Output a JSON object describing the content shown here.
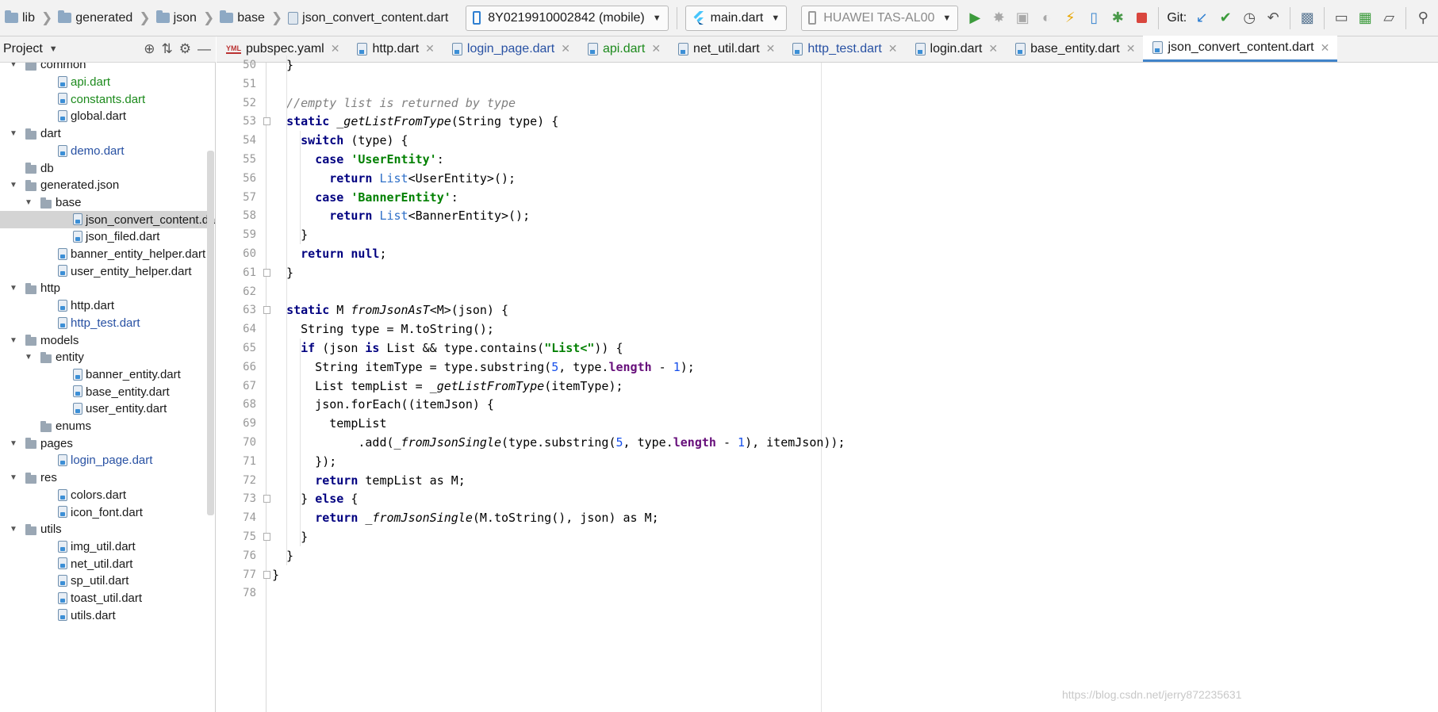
{
  "breadcrumb": {
    "items": [
      "lib",
      "generated",
      "json",
      "base",
      "json_convert_content.dart"
    ]
  },
  "toolbar": {
    "device_selector": "8Y0219910002842 (mobile)",
    "run_config": "main.dart",
    "target_device": "HUAWEI TAS-AL00",
    "git_label": "Git:",
    "icons": [
      "run-icon",
      "debug-icon",
      "profile-icon",
      "attach-icon",
      "hot-reload-icon",
      "device-icon",
      "stop-debug-icon",
      "stop-icon",
      "vcs-update-icon",
      "vcs-commit-icon",
      "history-icon",
      "revert-icon",
      "project-structure-icon",
      "terminal-icon",
      "avd-icon",
      "sdk-icon",
      "search-icon"
    ]
  },
  "project_panel": {
    "title": "Project",
    "tree": [
      {
        "label": "common",
        "kind": "folder",
        "depth": 1,
        "expanded": true,
        "color": "dark"
      },
      {
        "label": "api.dart",
        "kind": "file",
        "depth": 2,
        "color": "green"
      },
      {
        "label": "constants.dart",
        "kind": "file",
        "depth": 2,
        "color": "green"
      },
      {
        "label": "global.dart",
        "kind": "file",
        "depth": 2,
        "color": "dark"
      },
      {
        "label": "dart",
        "kind": "folder",
        "depth": 1,
        "expanded": true,
        "color": "dark"
      },
      {
        "label": "demo.dart",
        "kind": "file",
        "depth": 2,
        "color": "blue"
      },
      {
        "label": "db",
        "kind": "folder",
        "depth": 1,
        "expanded": false,
        "color": "dark"
      },
      {
        "label": "generated.json",
        "kind": "folder",
        "depth": 1,
        "expanded": true,
        "color": "dark"
      },
      {
        "label": "base",
        "kind": "folder",
        "depth": 2,
        "expanded": true,
        "color": "dark"
      },
      {
        "label": "json_convert_content.dart",
        "kind": "file",
        "depth": 3,
        "color": "dark",
        "selected": true
      },
      {
        "label": "json_filed.dart",
        "kind": "file",
        "depth": 3,
        "color": "dark"
      },
      {
        "label": "banner_entity_helper.dart",
        "kind": "file",
        "depth": 2,
        "color": "dark"
      },
      {
        "label": "user_entity_helper.dart",
        "kind": "file",
        "depth": 2,
        "color": "dark"
      },
      {
        "label": "http",
        "kind": "folder",
        "depth": 1,
        "expanded": true,
        "color": "dark"
      },
      {
        "label": "http.dart",
        "kind": "file",
        "depth": 2,
        "color": "dark"
      },
      {
        "label": "http_test.dart",
        "kind": "file",
        "depth": 2,
        "color": "blue"
      },
      {
        "label": "models",
        "kind": "folder",
        "depth": 1,
        "expanded": true,
        "color": "dark"
      },
      {
        "label": "entity",
        "kind": "folder",
        "depth": 2,
        "expanded": true,
        "color": "dark"
      },
      {
        "label": "banner_entity.dart",
        "kind": "file",
        "depth": 3,
        "color": "dark"
      },
      {
        "label": "base_entity.dart",
        "kind": "file",
        "depth": 3,
        "color": "dark"
      },
      {
        "label": "user_entity.dart",
        "kind": "file",
        "depth": 3,
        "color": "dark"
      },
      {
        "label": "enums",
        "kind": "folder",
        "depth": 2,
        "expanded": false,
        "color": "dark"
      },
      {
        "label": "pages",
        "kind": "folder",
        "depth": 1,
        "expanded": true,
        "color": "dark"
      },
      {
        "label": "login_page.dart",
        "kind": "file",
        "depth": 2,
        "color": "blue"
      },
      {
        "label": "res",
        "kind": "folder",
        "depth": 1,
        "expanded": true,
        "color": "dark"
      },
      {
        "label": "colors.dart",
        "kind": "file",
        "depth": 2,
        "color": "dark"
      },
      {
        "label": "icon_font.dart",
        "kind": "file",
        "depth": 2,
        "color": "dark"
      },
      {
        "label": "utils",
        "kind": "folder",
        "depth": 1,
        "expanded": true,
        "color": "dark"
      },
      {
        "label": "img_util.dart",
        "kind": "file",
        "depth": 2,
        "color": "dark"
      },
      {
        "label": "net_util.dart",
        "kind": "file",
        "depth": 2,
        "color": "dark"
      },
      {
        "label": "sp_util.dart",
        "kind": "file",
        "depth": 2,
        "color": "dark"
      },
      {
        "label": "toast_util.dart",
        "kind": "file",
        "depth": 2,
        "color": "dark"
      },
      {
        "label": "utils.dart",
        "kind": "file",
        "depth": 2,
        "color": "dark"
      }
    ]
  },
  "tabs": [
    {
      "label": "pubspec.yaml",
      "icon": "yaml-file-icon",
      "color": "dark",
      "active": false
    },
    {
      "label": "http.dart",
      "icon": "dart-file-icon",
      "color": "dark",
      "active": false
    },
    {
      "label": "login_page.dart",
      "icon": "dart-file-icon",
      "color": "blue",
      "active": false
    },
    {
      "label": "api.dart",
      "icon": "dart-file-icon",
      "color": "green",
      "active": false
    },
    {
      "label": "net_util.dart",
      "icon": "dart-file-icon",
      "color": "dark",
      "active": false
    },
    {
      "label": "http_test.dart",
      "icon": "dart-file-icon",
      "color": "blue",
      "active": false
    },
    {
      "label": "login.dart",
      "icon": "dart-file-icon",
      "color": "dark",
      "active": false
    },
    {
      "label": "base_entity.dart",
      "icon": "dart-file-icon",
      "color": "dark",
      "active": false
    },
    {
      "label": "json_convert_content.dart",
      "icon": "dart-file-icon",
      "color": "dark",
      "active": true
    }
  ],
  "editor": {
    "lines": [
      {
        "num": "50",
        "text": "  }"
      },
      {
        "num": "51",
        "text": ""
      },
      {
        "num": "52",
        "text": "  //empty list is returned by type"
      },
      {
        "num": "53",
        "text": "  static _getListFromType(String type) {"
      },
      {
        "num": "54",
        "text": "    switch (type) {"
      },
      {
        "num": "55",
        "text": "      case 'UserEntity':"
      },
      {
        "num": "56",
        "text": "        return List<UserEntity>();"
      },
      {
        "num": "57",
        "text": "      case 'BannerEntity':"
      },
      {
        "num": "58",
        "text": "        return List<BannerEntity>();"
      },
      {
        "num": "59",
        "text": "    }"
      },
      {
        "num": "60",
        "text": "    return null;"
      },
      {
        "num": "61",
        "text": "  }"
      },
      {
        "num": "62",
        "text": ""
      },
      {
        "num": "63",
        "text": "  static M fromJsonAsT<M>(json) {"
      },
      {
        "num": "64",
        "text": "    String type = M.toString();"
      },
      {
        "num": "65",
        "text": "    if (json is List && type.contains(\"List<\")) {"
      },
      {
        "num": "66",
        "text": "      String itemType = type.substring(5, type.length - 1);"
      },
      {
        "num": "67",
        "text": "      List tempList = _getListFromType(itemType);"
      },
      {
        "num": "68",
        "text": "      json.forEach((itemJson) {"
      },
      {
        "num": "69",
        "text": "        tempList"
      },
      {
        "num": "70",
        "text": "            .add(_fromJsonSingle(type.substring(5, type.length - 1), itemJson));"
      },
      {
        "num": "71",
        "text": "      });"
      },
      {
        "num": "72",
        "text": "      return tempList as M;"
      },
      {
        "num": "73",
        "text": "    } else {"
      },
      {
        "num": "74",
        "text": "      return _fromJsonSingle(M.toString(), json) as M;"
      },
      {
        "num": "75",
        "text": "    }"
      },
      {
        "num": "76",
        "text": "  }"
      },
      {
        "num": "77",
        "text": "}"
      },
      {
        "num": "78",
        "text": ""
      }
    ]
  },
  "watermark": "https://blog.csdn.net/jerry872235631",
  "colors": {
    "keyword": "#000080",
    "string": "#008000",
    "comment": "#808080",
    "number": "#1750eb",
    "type_ref": "#2f70c8",
    "field": "#660e7a",
    "active_tab_underline": "#4083c9",
    "selection": "#d4d4d4"
  }
}
